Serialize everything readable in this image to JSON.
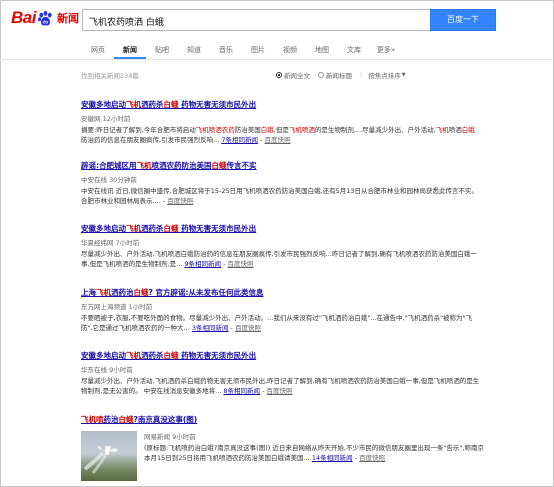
{
  "header": {
    "logo_bai": "Bai",
    "logo_du": "du",
    "logo_news": "新闻",
    "search_value": "飞机农药喷洒 白蛾",
    "search_button": "百度一下"
  },
  "nav": {
    "tabs": [
      "网页",
      "新闻",
      "贴吧",
      "知道",
      "音乐",
      "图片",
      "视频",
      "地图",
      "文库",
      "更多»"
    ]
  },
  "stats": {
    "text": "找到相关新闻234篇",
    "opt_full": "新闻全文",
    "opt_title": "新闻标题",
    "sort": "按焦点排序"
  },
  "results": [
    {
      "title_a": "安徽多地启动",
      "title_hl1": "飞机",
      "title_b": "洒药杀",
      "title_hl2": "白蛾",
      "title_c": " 药物无害无须市民外出",
      "src": "安徽网 12小时前",
      "abs_a": "摘要:昨日记者了解到,今年合肥市将启动",
      "abs_hl1": "飞机喷洒农药",
      "abs_b": "防治美国",
      "abs_hl2": "白蛾",
      "abs_c": ",但是",
      "abs_hl3": "飞机喷洒",
      "abs_d": "的是生物制剂,...尽量减少外出、户外活动,",
      "abs_hl4": "飞机",
      "abs_e": "喷洒",
      "abs_hl5": "白蛾",
      "abs_f": "防治药的信息在朋友圈疯传,引发市民强烈反响...",
      "more": "7条相同新闻",
      "snap": "百度快照"
    },
    {
      "title_a": "辟谣:合肥城区用",
      "title_hl1": "飞机",
      "title_b": "喷洒农药防治美国",
      "title_hl2": "白蛾",
      "title_c": "传言不实",
      "src": "中安在线 30分钟前",
      "abs": "中安在线讯 近日,微信圈中盛传,合肥城区将于15-25日用飞机喷洒农药防治美国白蛾,还有5月13日从合肥市林业和园林局获悉此传言不实。 合肥市林业和园林局表示,...",
      "snap": "百度快照"
    },
    {
      "title_a": "安徽多地启动",
      "title_hl1": "飞机",
      "title_b": "洒药杀",
      "title_hl2": "白蛾",
      "title_c": " 药物无害无须市民外出",
      "src": "华夏经纬网 7小时前",
      "abs": "尽量减少外出、户外活动,飞机喷洒白蛾防治药的信息在朋友圈疯传,引发市民强烈反响...昨日记者了解到,确有飞机喷洒农药防治美国白蛾一事,但是飞机喷洒的是生物制剂,是...",
      "more": "9条相同新闻",
      "snap": "百度快照"
    },
    {
      "title_a": "上海",
      "title_hl1": "飞机",
      "title_b": "洒药治",
      "title_hl2": "白蛾",
      "title_c": "? 官方辟谣:从未发布任何此类信息",
      "src": "东方网上海频道 1小时前",
      "abs": "不要晒被子,衣服,不要吃外面的食物。尽量减少外出、户外活动。...我们从来没有过\"飞机洒药治白蛾\"...在通告中,\"飞机洒药杀\"被称为\"飞防\",它是通过飞机喷洒农药的一种大...",
      "more": "3条相同新闻",
      "snap": "百度快照"
    },
    {
      "title_a": "安徽多地启动",
      "title_hl1": "飞机",
      "title_b": "洒药杀",
      "title_hl2": "白蛾",
      "title_c": " 药物无害无须市民外出",
      "src": "华东在线 9小时前",
      "abs": "尽量减少外出、户外活动,飞机洒药杀白蛾药物无害无须市民外出,昨日记者了解到,确有飞机喷洒农药防治美国白蛾一事,但是飞机喷洒的是生物制剂,是无公害的。 中安在线消息安徽多地将...",
      "more": "8条相同新闻",
      "snap": "百度快照"
    },
    {
      "title_a": "",
      "title_hl1": "飞机喷",
      "title_b": "药治",
      "title_hl2": "白蛾",
      "title_c": "?南京真没这事(图)",
      "src": "网易新闻 9小时前",
      "abs": "(原标题:飞机喷药治白蛾?南京真没这事(图)) 近日来自网络从昨天开始,不少市民的微信朋友圈里出现一条\"告示\",称南京本月15日到25日将用飞机喷洒农药防治美国白蛾请美国...",
      "more": "14条相同新闻",
      "snap": "百度快照"
    }
  ],
  "colors": {
    "brand_red": "#e10602",
    "brand_blue": "#2932e1",
    "search_button": "#3385ff",
    "link": "#1a0dab",
    "highlight": "#c00"
  }
}
